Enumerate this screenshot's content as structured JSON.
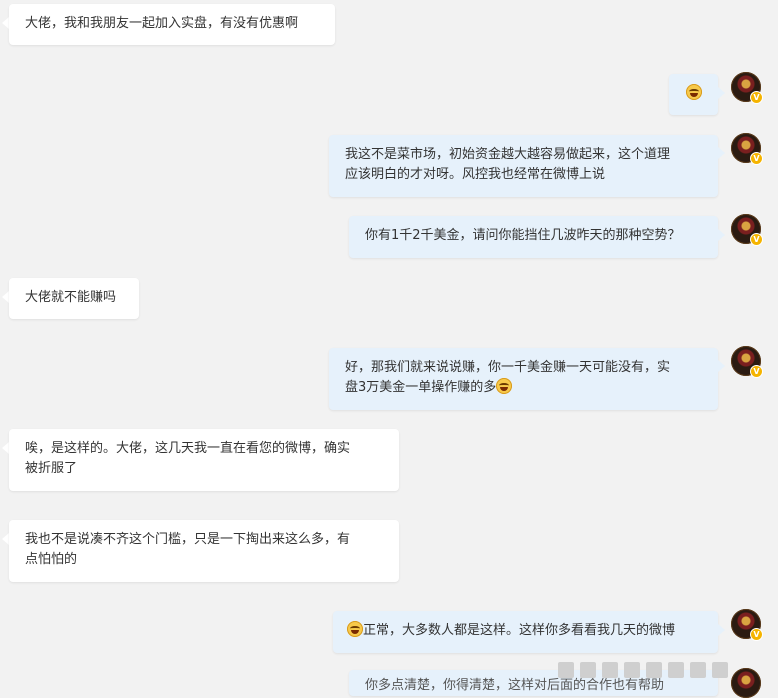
{
  "messages": [
    {
      "side": "left",
      "text": "大佬，我和我朋友一起加入实盘，有没有优惠啊"
    },
    {
      "side": "right",
      "emoji": "laugh-cry",
      "text": ""
    },
    {
      "side": "right",
      "line1": "我这不是菜市场，初始资金越大越容易做起来，这个道理",
      "line2": "应该明白的才对呀。风控我也经常在微博上说"
    },
    {
      "side": "right",
      "text": "你有1千2千美金，请问你能挡住几波昨天的那种空势？"
    },
    {
      "side": "left",
      "text": "大佬就不能赚吗"
    },
    {
      "side": "right",
      "line1": "好，那我们就来说说赚，你一千美金赚一天可能没有，实",
      "line2": "盘3万美金一单操作赚的多"
    },
    {
      "side": "left",
      "line1": "唉，是这样的。大佬，这几天我一直在看您的微博，确实",
      "line2": "被折服了"
    },
    {
      "side": "left",
      "line1": "我也不是说凑不齐这个门槛，只是一下掏出来这么多，有",
      "line2": "点怕怕的"
    },
    {
      "side": "right",
      "text": "正常，大多数人都是这样。这样你多看看我几天的微博"
    },
    {
      "side": "right",
      "text": "你多点清楚，你得清楚，这样对后面的合作也有帮助"
    }
  ],
  "badge_label": "V"
}
